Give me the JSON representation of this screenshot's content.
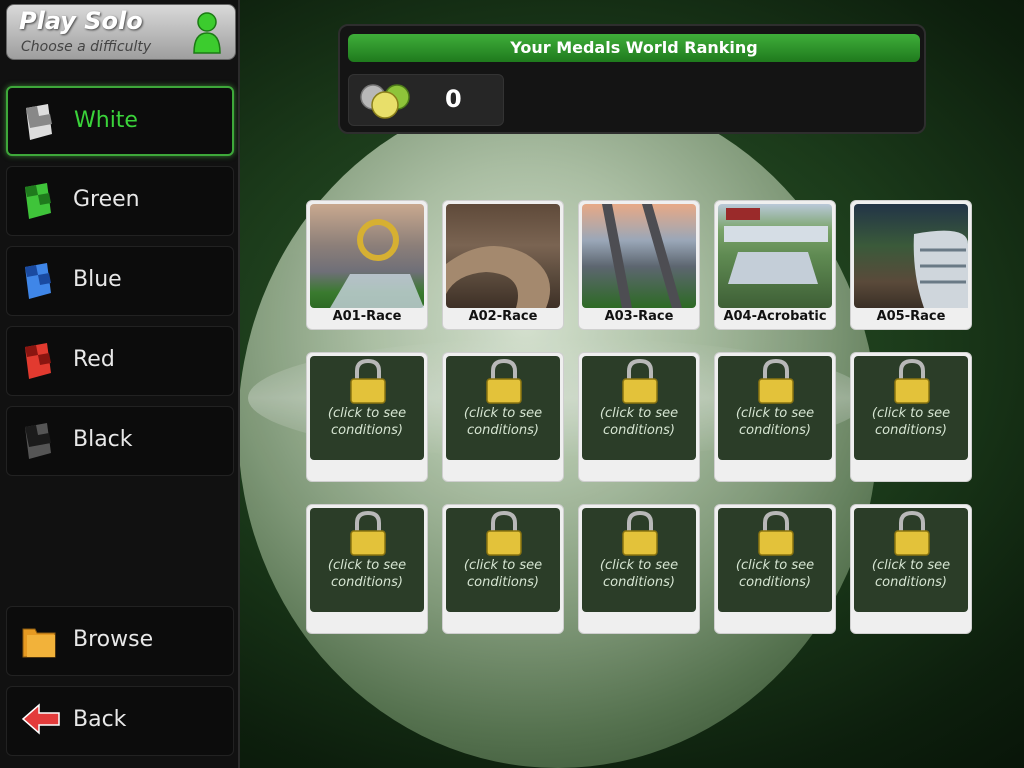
{
  "header": {
    "title": "Play Solo",
    "subtitle": "Choose a difficulty"
  },
  "difficulties": [
    {
      "label": "White",
      "active": true
    },
    {
      "label": "Green",
      "active": false
    },
    {
      "label": "Blue",
      "active": false
    },
    {
      "label": "Red",
      "active": false
    },
    {
      "label": "Black",
      "active": false
    }
  ],
  "nav": {
    "browse_label": "Browse",
    "back_label": "Back"
  },
  "medals": {
    "title": "Your Medals World Ranking",
    "count": "0"
  },
  "tracks": [
    {
      "name": "A01-Race"
    },
    {
      "name": "A02-Race"
    },
    {
      "name": "A03-Race"
    },
    {
      "name": "A04-Acrobatic"
    },
    {
      "name": "A05-Race"
    }
  ],
  "locked_track": {
    "conditions_line1": "(click to see",
    "conditions_line2": "conditions)"
  },
  "colors": {
    "accent": "#3ea83a",
    "active_text": "#3ad33a",
    "panel": "#141414"
  }
}
